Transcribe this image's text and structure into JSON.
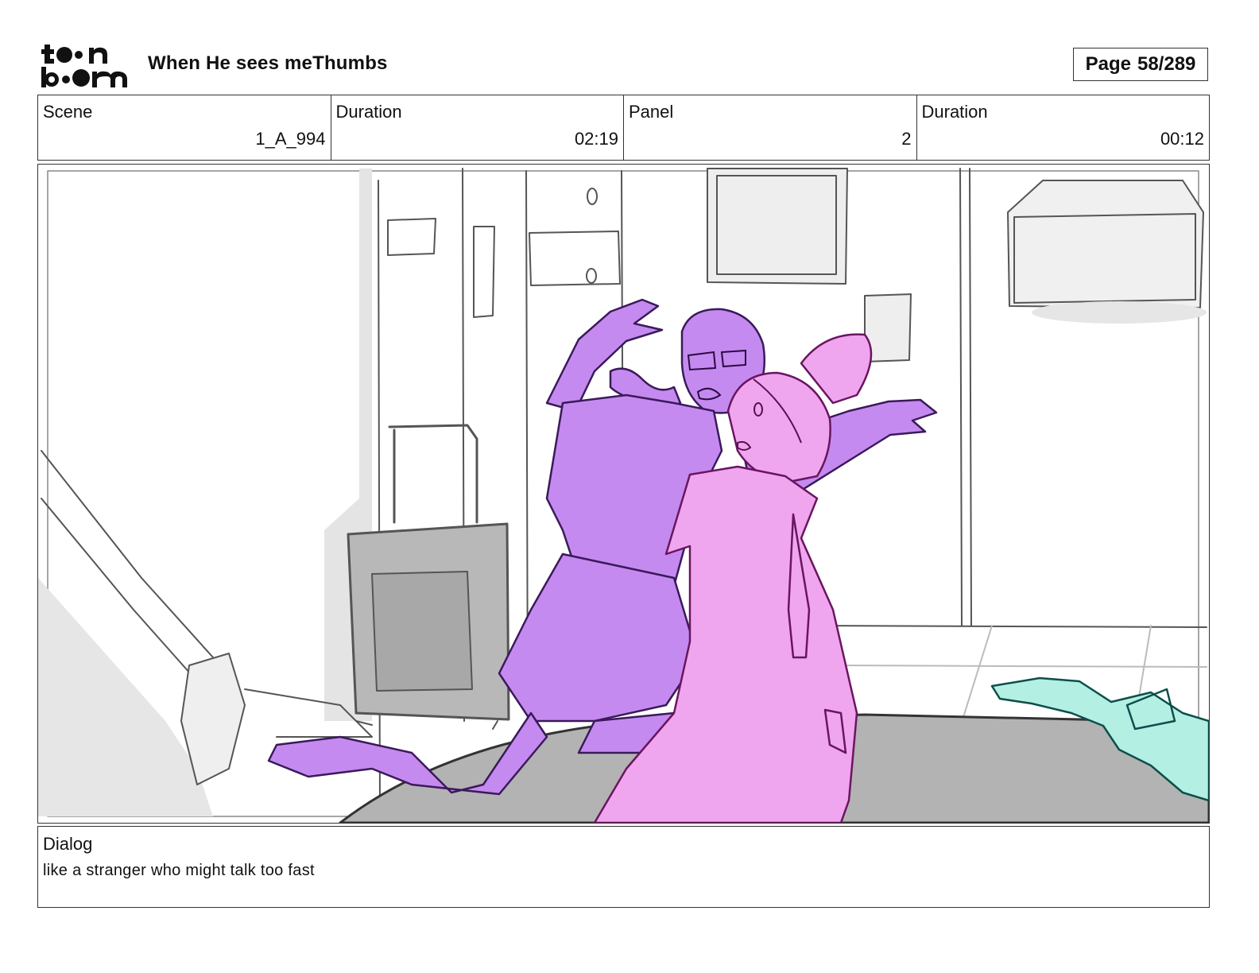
{
  "header": {
    "logo_text": "toon boom",
    "project_title": "When He sees meThumbs",
    "page_label": "Page",
    "page_value": "58/289"
  },
  "info": {
    "scene_label": "Scene",
    "scene_value": "1_A_994",
    "scene_duration_label": "Duration",
    "scene_duration_value": "02:19",
    "panel_label": "Panel",
    "panel_value": "2",
    "panel_duration_label": "Duration",
    "panel_duration_value": "00:12"
  },
  "dialog": {
    "label": "Dialog",
    "text": "like a stranger who might talk too fast"
  },
  "colors": {
    "purple_character": "#c58af0",
    "pink_character": "#f0a6ee",
    "teal_character": "#b4efe4",
    "grey_floor": "#b3b3b3",
    "sketch_line": "#555555"
  }
}
